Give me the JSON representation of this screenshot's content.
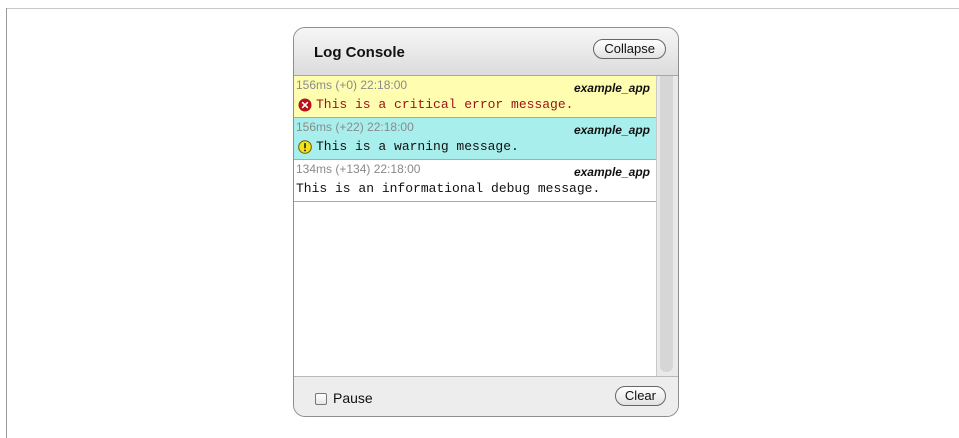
{
  "console": {
    "title": "Log Console",
    "collapse_label": "Collapse",
    "clear_label": "Clear",
    "pause_label": "Pause",
    "pause_checked": false
  },
  "entries": [
    {
      "level": "error",
      "meta": "156ms (+0) 22:18:00",
      "source": "example_app",
      "message": "This is a critical error message.",
      "icon": "error-icon"
    },
    {
      "level": "warn",
      "meta": "156ms (+22) 22:18:00",
      "source": "example_app",
      "message": "This is a warning message.",
      "icon": "warning-icon"
    },
    {
      "level": "info",
      "meta": "134ms (+134) 22:18:00",
      "source": "example_app",
      "message": "This is an informational debug message."
    }
  ],
  "colors": {
    "error_bg": "#fffeb0",
    "warn_bg": "#a8eeed",
    "error_text": "#9b1212"
  }
}
